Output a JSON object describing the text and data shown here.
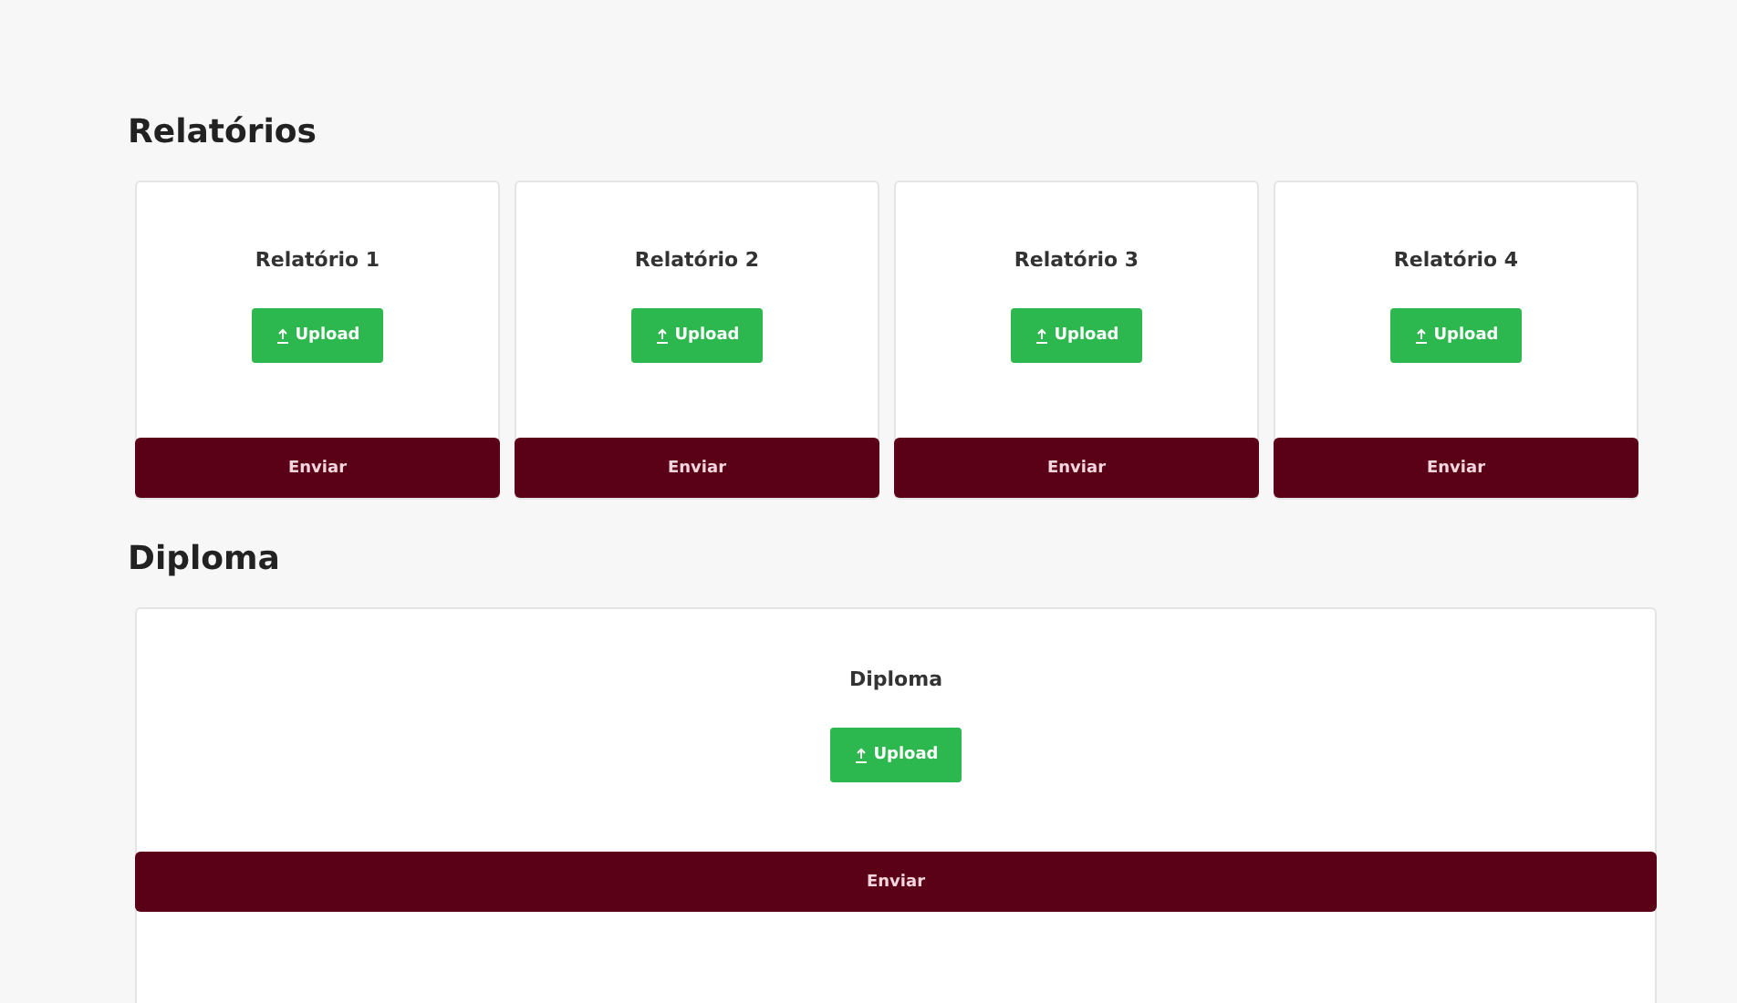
{
  "sections": [
    {
      "title": "Relatórios",
      "kind": "grid",
      "cards": [
        {
          "title": "Relatório 1",
          "upload": "Upload",
          "submit": "Enviar"
        },
        {
          "title": "Relatório 2",
          "upload": "Upload",
          "submit": "Enviar"
        },
        {
          "title": "Relatório 3",
          "upload": "Upload",
          "submit": "Enviar"
        },
        {
          "title": "Relatório 4",
          "upload": "Upload",
          "submit": "Enviar"
        }
      ]
    },
    {
      "title": "Diploma",
      "kind": "wide",
      "cards": [
        {
          "title": "Diploma",
          "upload": "Upload",
          "submit": "Enviar"
        }
      ]
    }
  ]
}
